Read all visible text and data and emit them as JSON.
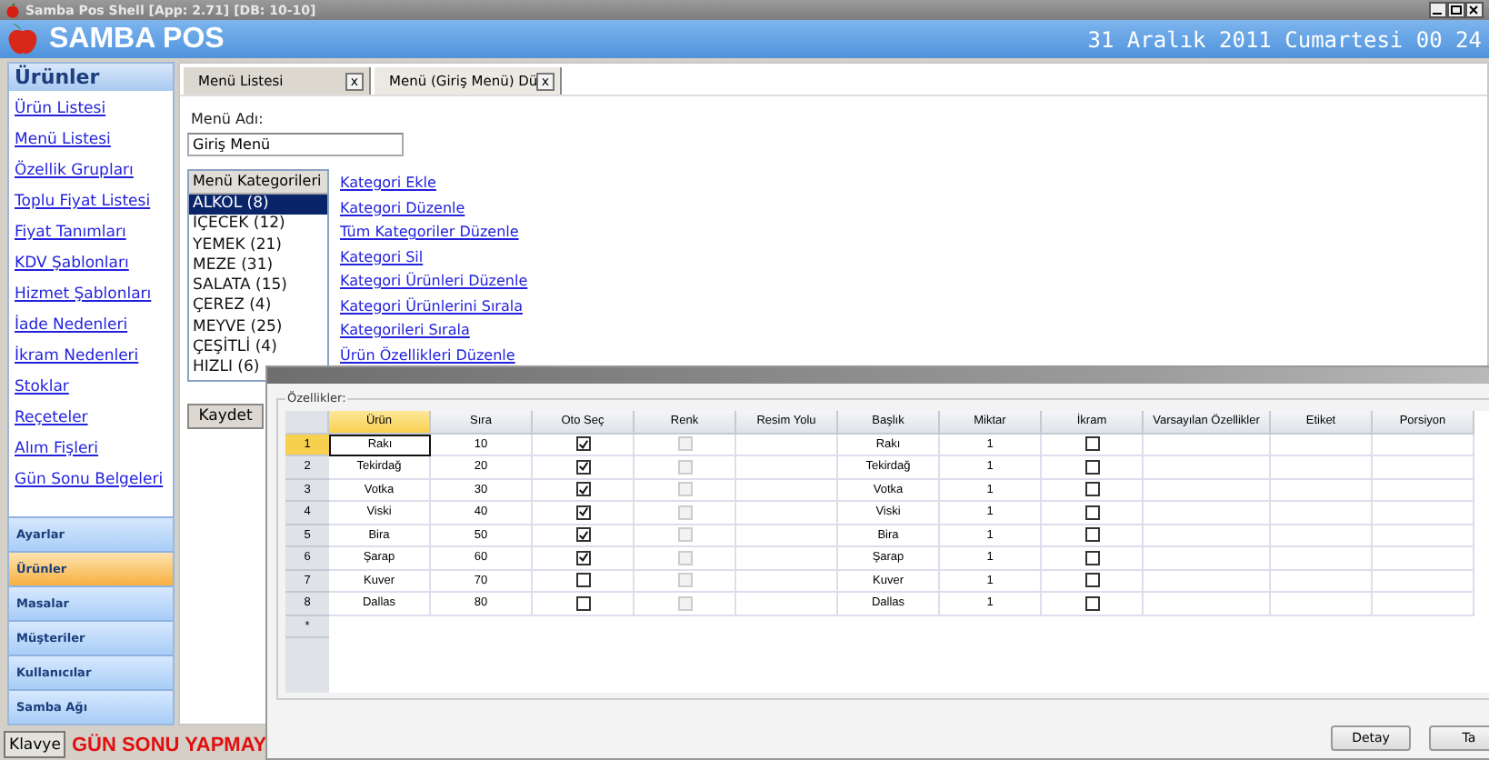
{
  "window": {
    "title": "Samba Pos Shell [App: 2.71] [DB: 10-10]"
  },
  "header": {
    "brand": "SAMBA POS",
    "datetime": "31 Aralık 2011 Cumartesi 00 24"
  },
  "sidebar": {
    "title": "Ürünler",
    "links": [
      "Ürün Listesi",
      "Menü Listesi",
      "Özellik Grupları",
      "Toplu Fiyat Listesi",
      "Fiyat Tanımları",
      "KDV Şablonları",
      "Hizmet Şablonları",
      "İade Nedenleri",
      "İkram Nedenleri",
      "Stoklar",
      "Reçeteler",
      "Alım Fişleri",
      "Gün Sonu Belgeleri"
    ],
    "sections": [
      {
        "label": "Ayarlar",
        "selected": false
      },
      {
        "label": "Ürünler",
        "selected": true
      },
      {
        "label": "Masalar",
        "selected": false
      },
      {
        "label": "Müşteriler",
        "selected": false
      },
      {
        "label": "Kullanıcılar",
        "selected": false
      },
      {
        "label": "Samba Ağı",
        "selected": false
      }
    ]
  },
  "tabs": [
    {
      "label": "Menü Listesi",
      "close": "x",
      "selected": false
    },
    {
      "label": "Menü (Giriş Menü) Dü",
      "close": "x",
      "selected": true
    }
  ],
  "form": {
    "name_label": "Menü Adı:",
    "name_value": "Giriş Menü",
    "categories_header": "Menü Kategorileri",
    "categories": [
      {
        "label": "ALKOL (8)",
        "selected": true
      },
      {
        "label": "İÇECEK (12)",
        "selected": false
      },
      {
        "label": "YEMEK (21)",
        "selected": false
      },
      {
        "label": "MEZE (31)",
        "selected": false
      },
      {
        "label": "SALATA (15)",
        "selected": false
      },
      {
        "label": "ÇEREZ (4)",
        "selected": false
      },
      {
        "label": "MEYVE (25)",
        "selected": false
      },
      {
        "label": "ÇEŞİTLİ (4)",
        "selected": false
      },
      {
        "label": "HIZLI (6)",
        "selected": false
      }
    ],
    "actions": [
      "Kategori Ekle",
      "Kategori Düzenle",
      "Tüm Kategoriler Düzenle",
      "Kategori Sil",
      "Kategori Ürünleri Düzenle",
      "Kategori Ürünlerini Sırala",
      "Kategorileri Sırala",
      "Ürün Özellikleri Düzenle"
    ],
    "save_button": "Kaydet"
  },
  "dialog": {
    "group_label": "Özellikler:",
    "columns": [
      {
        "label": "Ürün",
        "kind": "text",
        "selected": true
      },
      {
        "label": "Sıra",
        "kind": "text",
        "selected": false
      },
      {
        "label": "Oto Seç",
        "kind": "check",
        "selected": false,
        "disabled": false
      },
      {
        "label": "Renk",
        "kind": "check",
        "selected": false,
        "disabled": true
      },
      {
        "label": "Resim Yolu",
        "kind": "text",
        "selected": false
      },
      {
        "label": "Başlık",
        "kind": "text",
        "selected": false
      },
      {
        "label": "Miktar",
        "kind": "text",
        "selected": false
      },
      {
        "label": "İkram",
        "kind": "check",
        "selected": false,
        "disabled": false
      },
      {
        "label": "Varsayılan Özellikler",
        "kind": "text",
        "selected": false
      },
      {
        "label": "Etiket",
        "kind": "text",
        "selected": false
      },
      {
        "label": "Porsiyon",
        "kind": "text",
        "selected": false
      }
    ],
    "rows": [
      {
        "index": "1",
        "selected": true,
        "cells": [
          "Rakı",
          "10",
          true,
          false,
          null,
          "Rakı",
          "1",
          false,
          null,
          null,
          null
        ]
      },
      {
        "index": "2",
        "selected": false,
        "cells": [
          "Tekirdağ",
          "20",
          true,
          false,
          null,
          "Tekirdağ",
          "1",
          false,
          null,
          null,
          null
        ]
      },
      {
        "index": "3",
        "selected": false,
        "cells": [
          "Votka",
          "30",
          true,
          false,
          null,
          "Votka",
          "1",
          false,
          null,
          null,
          null
        ]
      },
      {
        "index": "4",
        "selected": false,
        "cells": [
          "Viski",
          "40",
          true,
          false,
          null,
          "Viski",
          "1",
          false,
          null,
          null,
          null
        ]
      },
      {
        "index": "5",
        "selected": false,
        "cells": [
          "Bira",
          "50",
          true,
          false,
          null,
          "Bira",
          "1",
          false,
          null,
          null,
          null
        ]
      },
      {
        "index": "6",
        "selected": false,
        "cells": [
          "Şarap",
          "60",
          true,
          false,
          null,
          "Şarap",
          "1",
          false,
          null,
          null,
          null
        ]
      },
      {
        "index": "7",
        "selected": false,
        "cells": [
          "Kuver",
          "70",
          false,
          false,
          null,
          "Kuver",
          "1",
          false,
          null,
          null,
          null
        ]
      },
      {
        "index": "8",
        "selected": false,
        "cells": [
          "Dallas",
          "80",
          false,
          false,
          null,
          "Dallas",
          "1",
          false,
          null,
          null,
          null
        ]
      }
    ],
    "new_row_marker": "*",
    "buttons": [
      "Detay",
      "Ta"
    ]
  },
  "status_bar": {
    "keyboard_button": "Klavye",
    "warning": "GÜN SONU YAPMAY"
  }
}
